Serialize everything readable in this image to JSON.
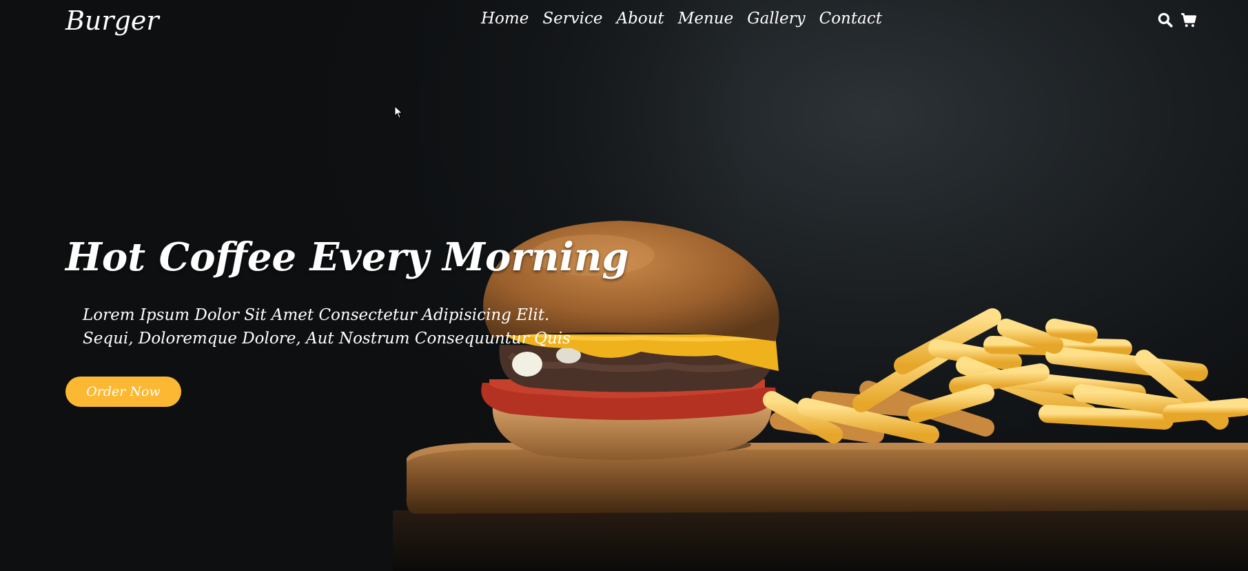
{
  "brand": {
    "logo": "Burger"
  },
  "nav": {
    "links": [
      "Home",
      "Service",
      "About",
      "Menue",
      "Gallery",
      "Contact"
    ],
    "icons": [
      "search-icon",
      "cart-icon"
    ]
  },
  "hero": {
    "title": "Hot Coffee Every Morning",
    "lines": [
      "Lorem Ipsum Dolor Sit Amet Consectetur Adipisicing Elit.",
      "Sequi, Doloremque Dolore, Aut Nostrum Consequuntur Quis"
    ],
    "cta": "Order Now"
  },
  "colors": {
    "accent": "#fcb832",
    "background": "#0f1113",
    "text": "#ffffff"
  }
}
